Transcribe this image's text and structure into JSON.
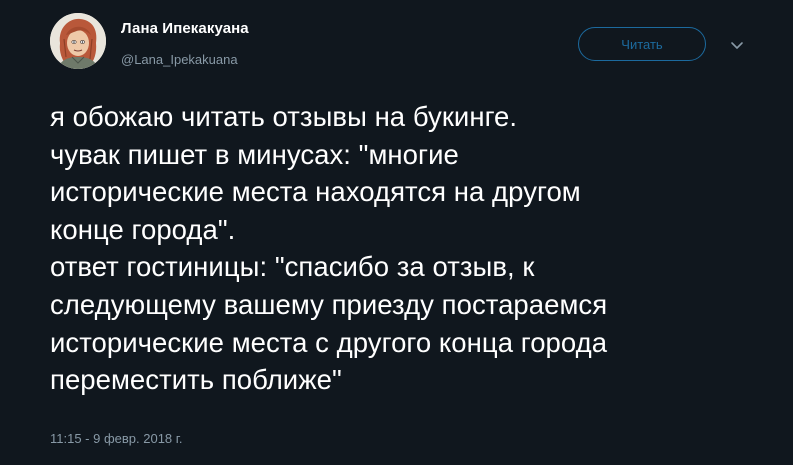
{
  "author": {
    "display_name": "Лана Ипекакуана",
    "handle": "@Lana_Ipekakuana",
    "avatar_icon": "avatar-illustration"
  },
  "follow_button": {
    "label": "Читать"
  },
  "menu": {
    "icon": "chevron-down-icon"
  },
  "tweet": {
    "lines": [
      "я обожаю читать отзывы на букинге.",
      "чувак пишет в минусах: \"многие",
      "исторические места находятся на другом",
      "конце города\".",
      "ответ гостиницы: \"спасибо за отзыв, к",
      "следующему вашему приезду постараемся",
      "исторические места с другого конца города",
      "переместить поближе\""
    ],
    "timestamp": "11:15 - 9 февр. 2018 г."
  },
  "colors": {
    "background": "#10171e",
    "text_primary": "#ffffff",
    "text_secondary": "#8899a6",
    "accent": "#1c6a9e"
  }
}
